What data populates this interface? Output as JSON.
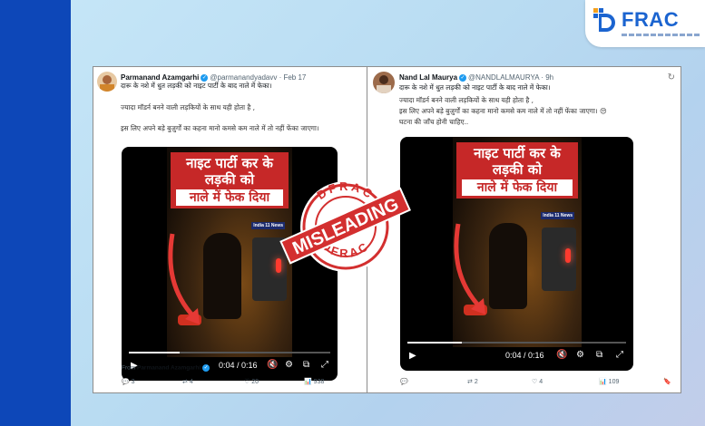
{
  "logo": {
    "text": "FRAC",
    "colors": {
      "blue": "#1b64d0",
      "accent": "#f4a01c"
    }
  },
  "left_tweet": {
    "name": "Parmanand Azamgarhi",
    "handle": "@parmanandyadavv",
    "date": "Feb 17",
    "line1": "दारू के नशे में धुत लड़की को नाइट पार्टी के बाद नाले में फेका।",
    "line2": "ज्यादा मॉडर्न बनने वाली लड़कियों के साथ यही होता है ,",
    "line3": "इस लिए अपने बड़े बुज़ुर्गों का कहना मानो कमसे कम नाले में तो नहीं फेंका जाएगा।",
    "video": {
      "banner_l1": "नाइट पार्टी कर के",
      "banner_l2": "लड़की को",
      "banner_l3": "नाले में फेक दिया",
      "news_badge": "India 11 News",
      "time": "0:04 / 0:16",
      "progress": 0.25
    },
    "from_prefix": "From",
    "from_name": "Parmanand Azamgarhi",
    "replies": "3",
    "reposts": "4",
    "likes": "20",
    "views": "938"
  },
  "right_tweet": {
    "name": "Nand Lal Maurya",
    "handle": "@NANDLALMAURYA",
    "date": "9h",
    "line1": "दारू के नशे में धुत लड़की को नाइट पार्टी के बाद नाले में फेका।",
    "line2": "ज्यादा मॉडर्न बनने वाली लड़कियों के साथ यही होता है ,",
    "line3": "इस लिए अपने बड़े बुज़ुर्गों का कहना मानो कमसे कम नाले में तो नहीं फेंका जाएगा। 😒",
    "line4": "घटना की जाँच होनी चाहिए..",
    "video": {
      "banner_l1": "नाइट पार्टी कर के",
      "banner_l2": "लड़की को",
      "banner_l3": "नाले में फेक दिया",
      "news_badge": "India 11 News",
      "time": "0:04 / 0:16",
      "progress": 0.25
    },
    "replies": "",
    "reposts": "2",
    "likes": "4",
    "views": "109"
  },
  "stamp": {
    "top": "DFRAC",
    "bottom": "DFRAC",
    "label": "MISLEADING",
    "color": "#d32f2f"
  }
}
